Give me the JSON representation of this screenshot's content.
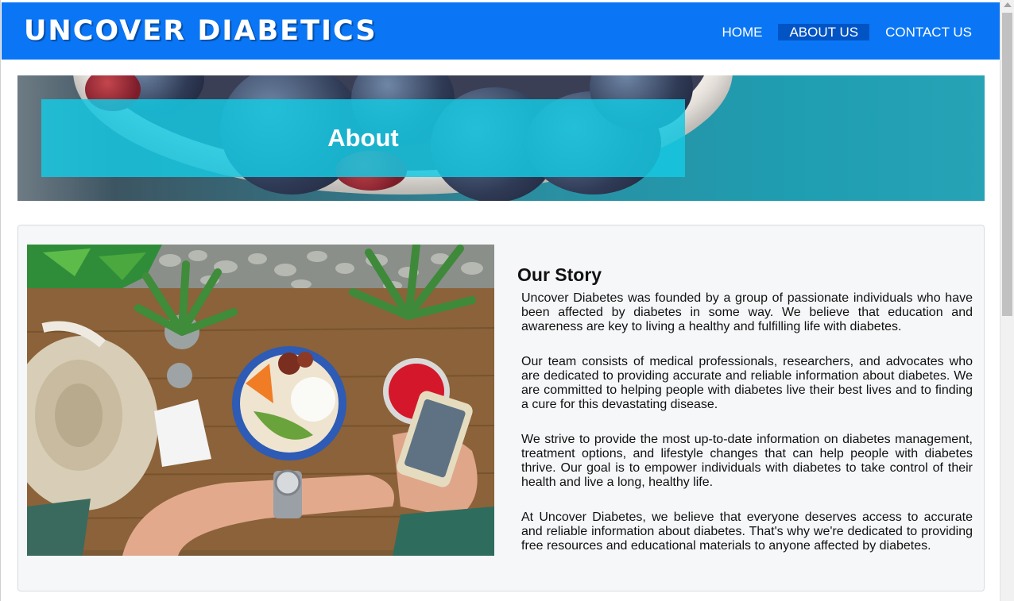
{
  "header": {
    "brand": "UNCOVER DIABETICS",
    "nav": [
      {
        "label": "HOME",
        "active": false
      },
      {
        "label": "ABOUT US",
        "active": true
      },
      {
        "label": "CONTACT US",
        "active": false
      }
    ]
  },
  "hero": {
    "title": "About"
  },
  "story": {
    "heading": "Our Story",
    "paragraphs": [
      "Uncover Diabetes was founded by a group of passionate individuals who have been affected by diabetes in some way. We believe that education and awareness are key to living a healthy and fulfilling life with diabetes.",
      "Our team consists of medical professionals, researchers, and advocates who are dedicated to providing accurate and reliable information about diabetes. We are committed to helping people with diabetes live their best lives and to finding a cure for this devastating disease.",
      "We strive to provide the most up-to-date information on diabetes management, treatment options, and lifestyle changes that can help people with diabetes thrive. Our goal is to empower individuals with diabetes to take control of their health and live a long, healthy life.",
      "At Uncover Diabetes, we believe that everyone deserves access to accurate and reliable information about diabetes. That's why we're dedicated to providing free resources and educational materials to anyone affected by diabetes."
    ]
  },
  "colors": {
    "header_bg": "#0a76f6",
    "nav_active_bg": "#0254c4",
    "hero_overlay": "#16c8e2",
    "card_bg": "#f6f7f9"
  }
}
